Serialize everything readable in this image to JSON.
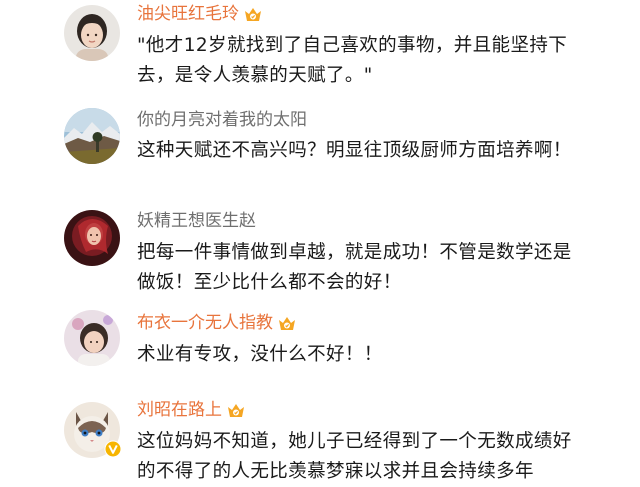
{
  "comments": [
    {
      "username": "油尖旺红毛玲",
      "text": "\"他才12岁就找到了自己喜欢的事物，并且能坚持下去，是令人羡慕的天赋了。\"",
      "name_color": "#e8743c",
      "has_vip_badge": true
    },
    {
      "username": "你的月亮对着我的太阳",
      "text": "这种天赋还不高兴吗？明显往顶级厨师方面培养啊！",
      "name_color": "#6f6f6f",
      "has_vip_badge": false
    },
    {
      "username": "妖精王想医生赵",
      "text": "把每一件事情做到卓越，就是成功！不管是数学还是做饭！至少比什么都不会的好！",
      "name_color": "#6f6f6f",
      "has_vip_badge": false
    },
    {
      "username": "布衣一介无人指教",
      "text": "术业有专攻，没什么不好！！",
      "name_color": "#e8743c",
      "has_vip_badge": true
    },
    {
      "username": "刘昭在路上",
      "text": "这位妈妈不知道，她儿子已经得到了一个无数成绩好的不得了的人无比羡慕梦寐以求并且会持续多年",
      "name_color": "#e8743c",
      "has_vip_badge": true,
      "has_verified_badge": true
    }
  ],
  "icons": {
    "vip_badge": "vip-crown-badge-icon",
    "verified_badge": "verified-v-badge-icon"
  },
  "colors": {
    "vip_name": "#e8743c",
    "normal_name": "#6f6f6f",
    "text": "#1a1a1a",
    "badge_orange": "#f5a623",
    "verified": "#f7b500"
  }
}
